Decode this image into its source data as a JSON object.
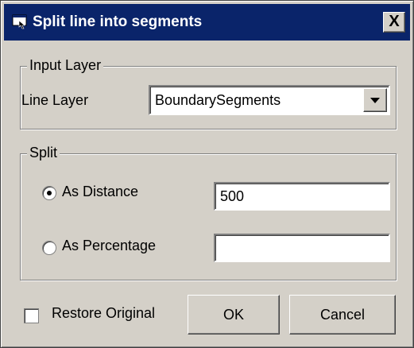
{
  "window": {
    "title": "Split line into segments",
    "close_label": "X"
  },
  "input_layer": {
    "group_label": "Input Layer",
    "line_layer_label": "Line Layer",
    "line_layer_value": "BoundarySegments"
  },
  "split": {
    "group_label": "Split",
    "as_distance_label": "As Distance",
    "as_distance_value": "500",
    "as_distance_selected": true,
    "as_percentage_label": "As Percentage",
    "as_percentage_value": "",
    "as_percentage_selected": false
  },
  "footer": {
    "restore_original_label": "Restore Original",
    "restore_original_checked": false,
    "ok_label": "OK",
    "cancel_label": "Cancel"
  }
}
